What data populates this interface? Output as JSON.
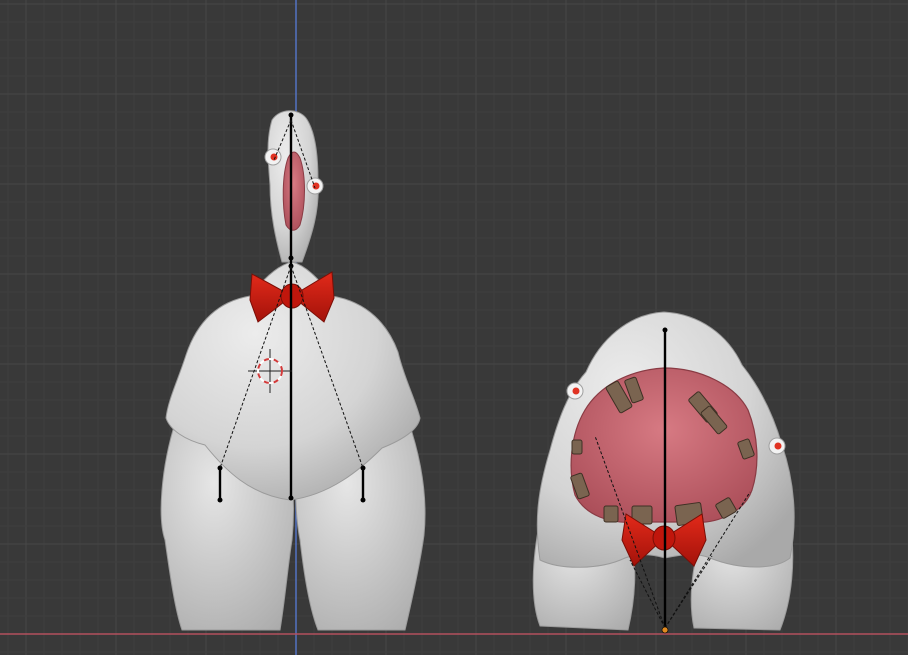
{
  "viewport": {
    "background": "#393939",
    "grid_minor_color": "#3e3e3e",
    "grid_major_color": "#474747",
    "z_axis_color": "#5577cc",
    "x_axis_color": "#b3505e"
  },
  "objects": [
    {
      "name": "tall-creature",
      "body_color": "#d9d9d9",
      "mouth_color": "#c9646e",
      "bowtie_color": "#cc1a10"
    },
    {
      "name": "round-creature",
      "body_color": "#d9d9d9",
      "mouth_color": "#c9646e",
      "bowtie_color": "#cc1a10",
      "teeth_color": "#7a6450"
    }
  ],
  "cursor": {
    "icon": "3d-cursor-icon",
    "colors": [
      "#d23a3a",
      "#ffffff"
    ]
  },
  "origin_marker_color": "#e08a20"
}
